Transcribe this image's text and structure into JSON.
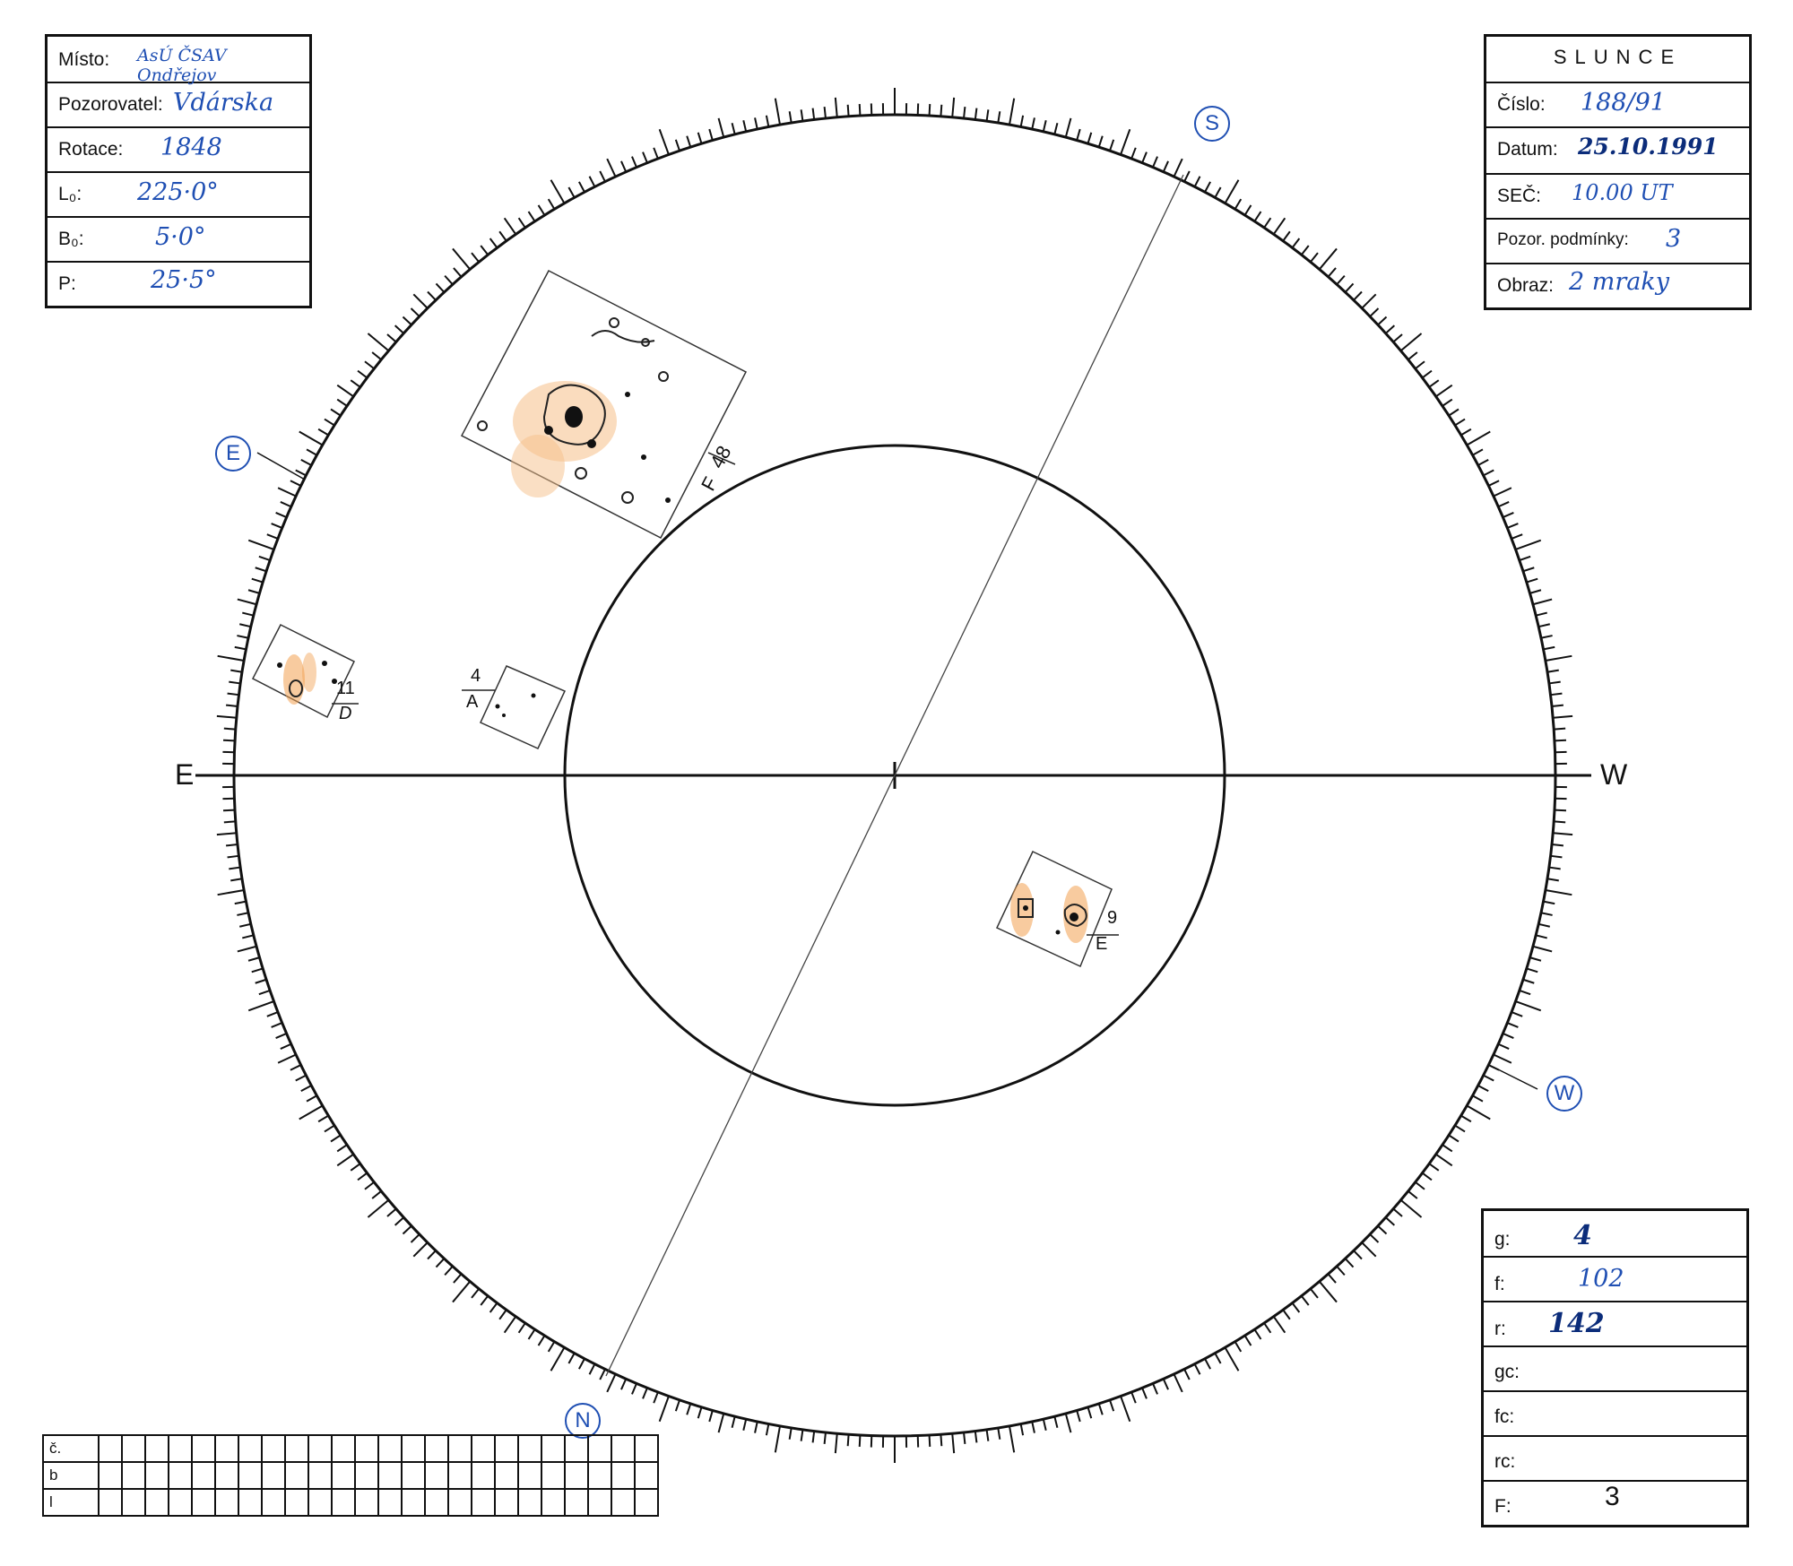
{
  "observation_form": {
    "fields": [
      {
        "label": "Místo:",
        "value": "AsÚ ČSAV Ondřejov"
      },
      {
        "label": "Pozorovatel:",
        "value": "Vdárska"
      },
      {
        "label": "Rotace:",
        "value": "1848"
      },
      {
        "label": "L₀:",
        "value": "225·0°"
      },
      {
        "label": "B₀:",
        "value": "5·0°"
      },
      {
        "label": "P:",
        "value": "25·5°"
      }
    ]
  },
  "sun_form": {
    "title": "SLUNCE",
    "fields": [
      {
        "label": "Číslo:",
        "value": "188/91"
      },
      {
        "label": "Datum:",
        "value": "25.10.1991"
      },
      {
        "label": "SEČ:",
        "value": "10.00 UT"
      },
      {
        "label": "Pozor. podmínky:",
        "value": "3"
      },
      {
        "label": "Obraz:",
        "value": "2 mraky"
      }
    ]
  },
  "disk": {
    "east_label": "E",
    "west_label": "W",
    "north_marker": "N",
    "south_marker": "S",
    "east_marker": "E",
    "west_marker": "W",
    "groups": [
      {
        "number": "48",
        "class": "F"
      },
      {
        "number": "11",
        "class": "D"
      },
      {
        "number": "4",
        "class": "A"
      },
      {
        "number": "9",
        "class": "E"
      }
    ]
  },
  "counts_form": {
    "fields": [
      {
        "label": "g:",
        "value": "4"
      },
      {
        "label": "f:",
        "value": "102"
      },
      {
        "label": "r:",
        "value": "142"
      },
      {
        "label": "gc:",
        "value": ""
      },
      {
        "label": "fc:",
        "value": ""
      },
      {
        "label": "rc:",
        "value": ""
      },
      {
        "label": "F:",
        "value": "3"
      }
    ]
  },
  "bottom_table": {
    "row_labels": [
      "č.",
      "b",
      "l"
    ]
  },
  "colors": {
    "ink": "#1f4fb3",
    "faculae": "#f0a55a"
  }
}
